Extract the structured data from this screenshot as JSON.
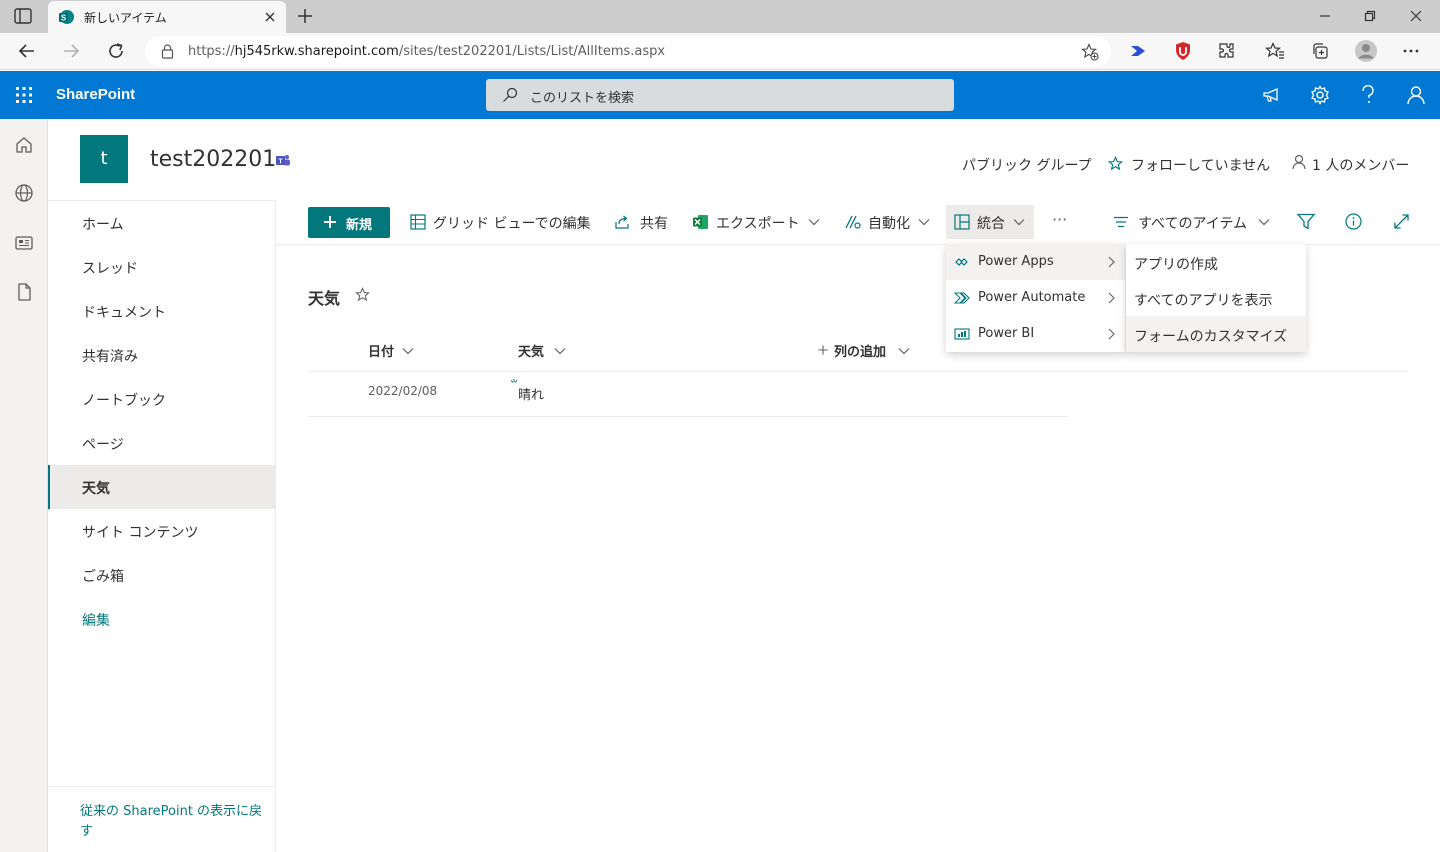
{
  "browser": {
    "tab_title": "新しいアイテム",
    "url_prefix": "https://",
    "url_host": "hj545rkw.sharepoint.com",
    "url_path": "/sites/test202201/Lists/List/AllItems.aspx"
  },
  "suite": {
    "brand": "SharePoint",
    "search_placeholder": "このリストを検索"
  },
  "site": {
    "logo_letter": "t",
    "title": "test202201",
    "group_type": "パブリック グループ",
    "follow": "フォローしていません",
    "members": "1 人のメンバー"
  },
  "nav": {
    "items": [
      "ホーム",
      "スレッド",
      "ドキュメント",
      "共有済み",
      "ノートブック",
      "ページ",
      "天気",
      "サイト コンテンツ",
      "ごみ箱"
    ],
    "selected": "天気",
    "edit": "編集",
    "classic_link": "従来の SharePoint の表示に戻す"
  },
  "commands": {
    "new": "新規",
    "grid_edit": "グリッド ビューでの編集",
    "share": "共有",
    "export": "エクスポート",
    "automate": "自動化",
    "integrate": "統合",
    "more": "···",
    "view": "すべてのアイテム"
  },
  "list": {
    "title": "天気",
    "columns": [
      "日付",
      "天気",
      "列の追加"
    ],
    "rows": [
      {
        "date": "2022/02/08",
        "weather": "晴れ"
      }
    ]
  },
  "integrate_menu": {
    "items": [
      "Power Apps",
      "Power Automate",
      "Power BI"
    ],
    "highlighted": "Power Apps"
  },
  "powerapps_menu": {
    "items": [
      "アプリの作成",
      "すべてのアプリを表示",
      "フォームのカスタマイズ"
    ],
    "hovered": "フォームのカスタマイズ"
  },
  "colors": {
    "suite_blue": "#0078d4",
    "theme_teal": "#03787c"
  }
}
